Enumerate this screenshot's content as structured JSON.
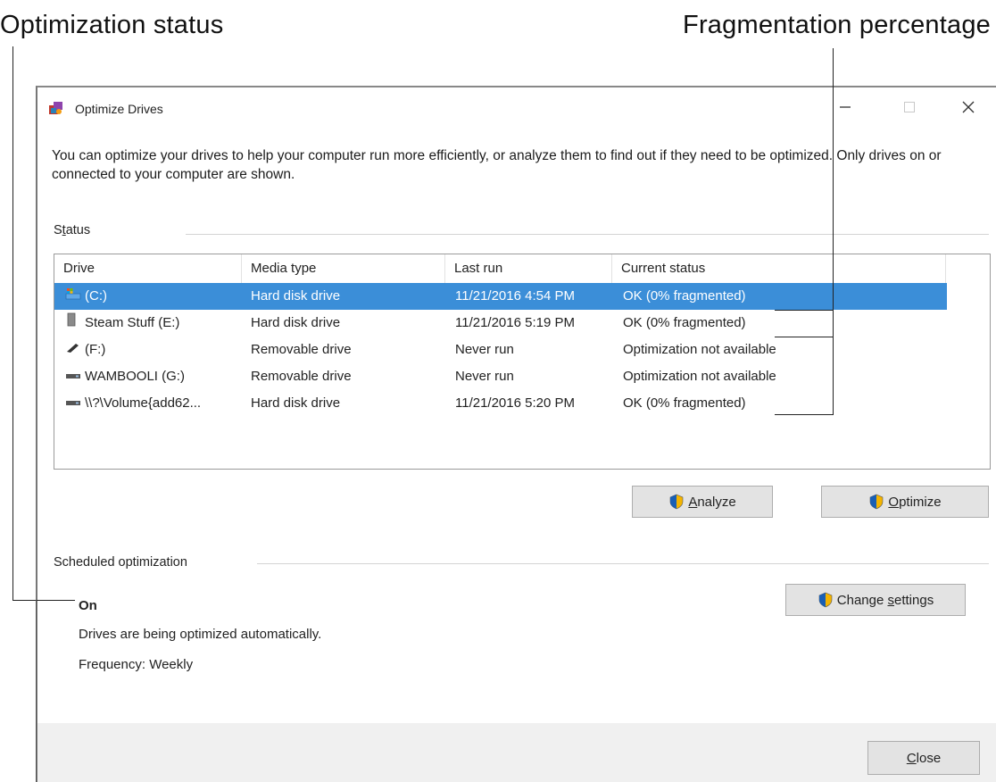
{
  "callouts": {
    "optimization_status": "Optimization status",
    "fragmentation_percentage": "Fragmentation percentage"
  },
  "window": {
    "title": "Optimize Drives",
    "icon": "optimize-drives-icon",
    "controls": {
      "minimize": "minimize-icon",
      "maximize": "maximize-icon",
      "close": "close-icon"
    }
  },
  "intro": "You can optimize your drives to help your computer run more efficiently, or analyze them to find out if they need to be optimized. Only drives on or connected to your computer are shown.",
  "status": {
    "label": "Status",
    "columns": [
      "Drive",
      "Media type",
      "Last run",
      "Current status"
    ],
    "rows": [
      {
        "icon": "system-drive-icon",
        "drive": "(C:)",
        "media": "Hard disk drive",
        "last_run": "11/21/2016 4:54 PM",
        "status": "OK (0% fragmented)",
        "selected": true
      },
      {
        "icon": "hard-drive-icon",
        "drive": "Steam Stuff (E:)",
        "media": "Hard disk drive",
        "last_run": "11/21/2016 5:19 PM",
        "status": "OK (0% fragmented)",
        "selected": false
      },
      {
        "icon": "usb-drive-icon",
        "drive": "(F:)",
        "media": "Removable drive",
        "last_run": "Never run",
        "status": "Optimization not available",
        "selected": false
      },
      {
        "icon": "removable-drive-icon",
        "drive": "WAMBOOLI (G:)",
        "media": "Removable drive",
        "last_run": "Never run",
        "status": "Optimization not available",
        "selected": false
      },
      {
        "icon": "volume-drive-icon",
        "drive": "\\\\?\\Volume{add62...",
        "media": "Hard disk drive",
        "last_run": "11/21/2016 5:20 PM",
        "status": "OK (0% fragmented)",
        "selected": false
      }
    ]
  },
  "buttons": {
    "analyze": {
      "accel": "A",
      "rest": "nalyze"
    },
    "optimize": {
      "accel": "O",
      "rest": "ptimize"
    },
    "change_settings": {
      "pre": "Change ",
      "accel": "s",
      "rest": "ettings"
    },
    "close": {
      "accel": "C",
      "rest": "lose"
    }
  },
  "scheduled": {
    "label": "Scheduled optimization",
    "state": "On",
    "description": "Drives are being optimized automatically.",
    "frequency": "Frequency: Weekly"
  },
  "colors": {
    "selection": "#3b8ed8",
    "footer": "#f0f0f0",
    "button": "#e3e3e3"
  }
}
